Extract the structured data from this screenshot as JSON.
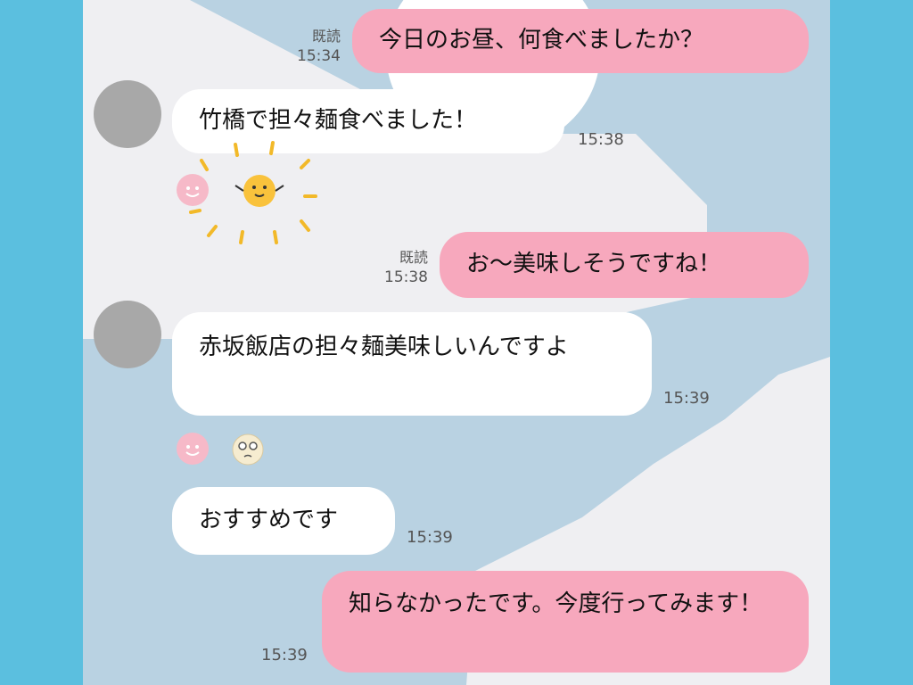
{
  "messages": [
    {
      "id": "m1",
      "side": "out",
      "text": "今日のお昼、何食べましたか？",
      "read": "既読",
      "time": "15:34"
    },
    {
      "id": "m2",
      "side": "in",
      "text": "竹橋で担々麺食べました！",
      "time": "15:38"
    },
    {
      "id": "m3",
      "side": "out",
      "text": "お〜美味しそうですね！",
      "read": "既読",
      "time": "15:38"
    },
    {
      "id": "m4",
      "side": "in",
      "text": "赤坂飯店の担々麺美味しいんですよ",
      "time": "15:39"
    },
    {
      "id": "m5",
      "side": "in",
      "text": "おすすめです",
      "time": "15:39"
    },
    {
      "id": "m6",
      "side": "out",
      "text": "知らなかったです。今度行ってみます！",
      "time": "15:39"
    }
  ],
  "reactions": [
    {
      "after": "m2",
      "icon": "smiling-face-reaction-icon",
      "sticker": "yellow-chick-sticker-icon"
    },
    {
      "after": "m4",
      "icon": "smiling-face-reaction-icon",
      "sticker": "thinking-face-sticker-icon"
    }
  ],
  "colors": {
    "outer_background": "#5bbfdf",
    "chat_background": "#b9d2e2",
    "outgoing_bubble": "#f7a8bd",
    "incoming_bubble": "#ffffff",
    "avatar_placeholder": "#a8a8a8"
  }
}
